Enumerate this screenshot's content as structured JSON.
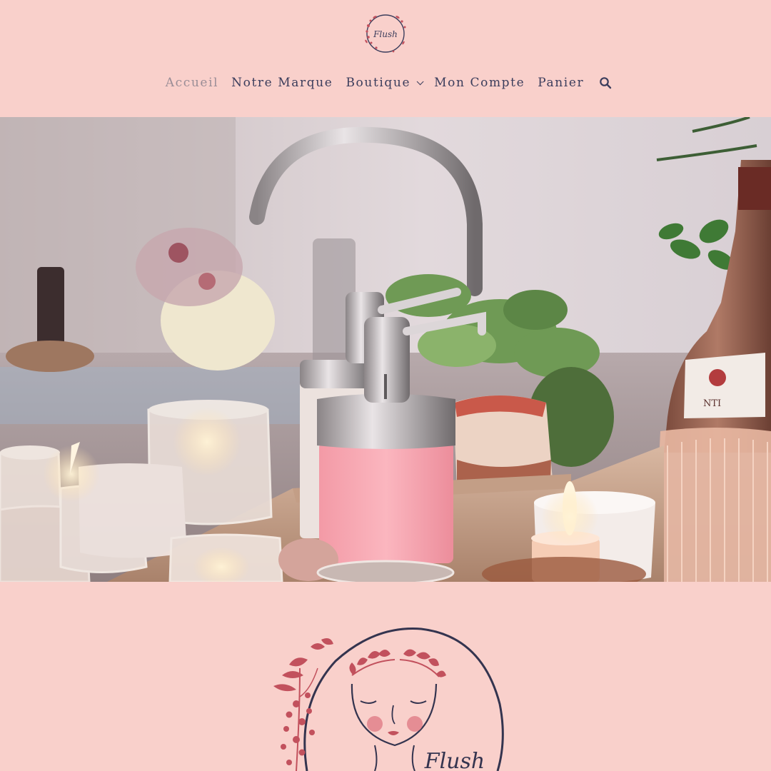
{
  "header": {
    "logo_text": "Flush",
    "logo_icon": "flush-wreath-logo",
    "nav": [
      {
        "label": "Accueil",
        "active": true
      },
      {
        "label": "Notre Marque",
        "active": false
      },
      {
        "label": "Boutique",
        "active": false,
        "has_dropdown": true
      },
      {
        "label": "Mon Compte",
        "active": false
      },
      {
        "label": "Panier",
        "active": false
      }
    ],
    "search_icon": "search-icon"
  },
  "hero": {
    "image_icon": "spa-products-photo"
  },
  "brand": {
    "logo_text": "Flush",
    "logo_icon": "flush-face-logo"
  },
  "colors": {
    "background": "#f9d0cb",
    "nav_text": "#3b3d5c",
    "nav_active": "#9a8d96",
    "accent_rose": "#c2515d"
  }
}
